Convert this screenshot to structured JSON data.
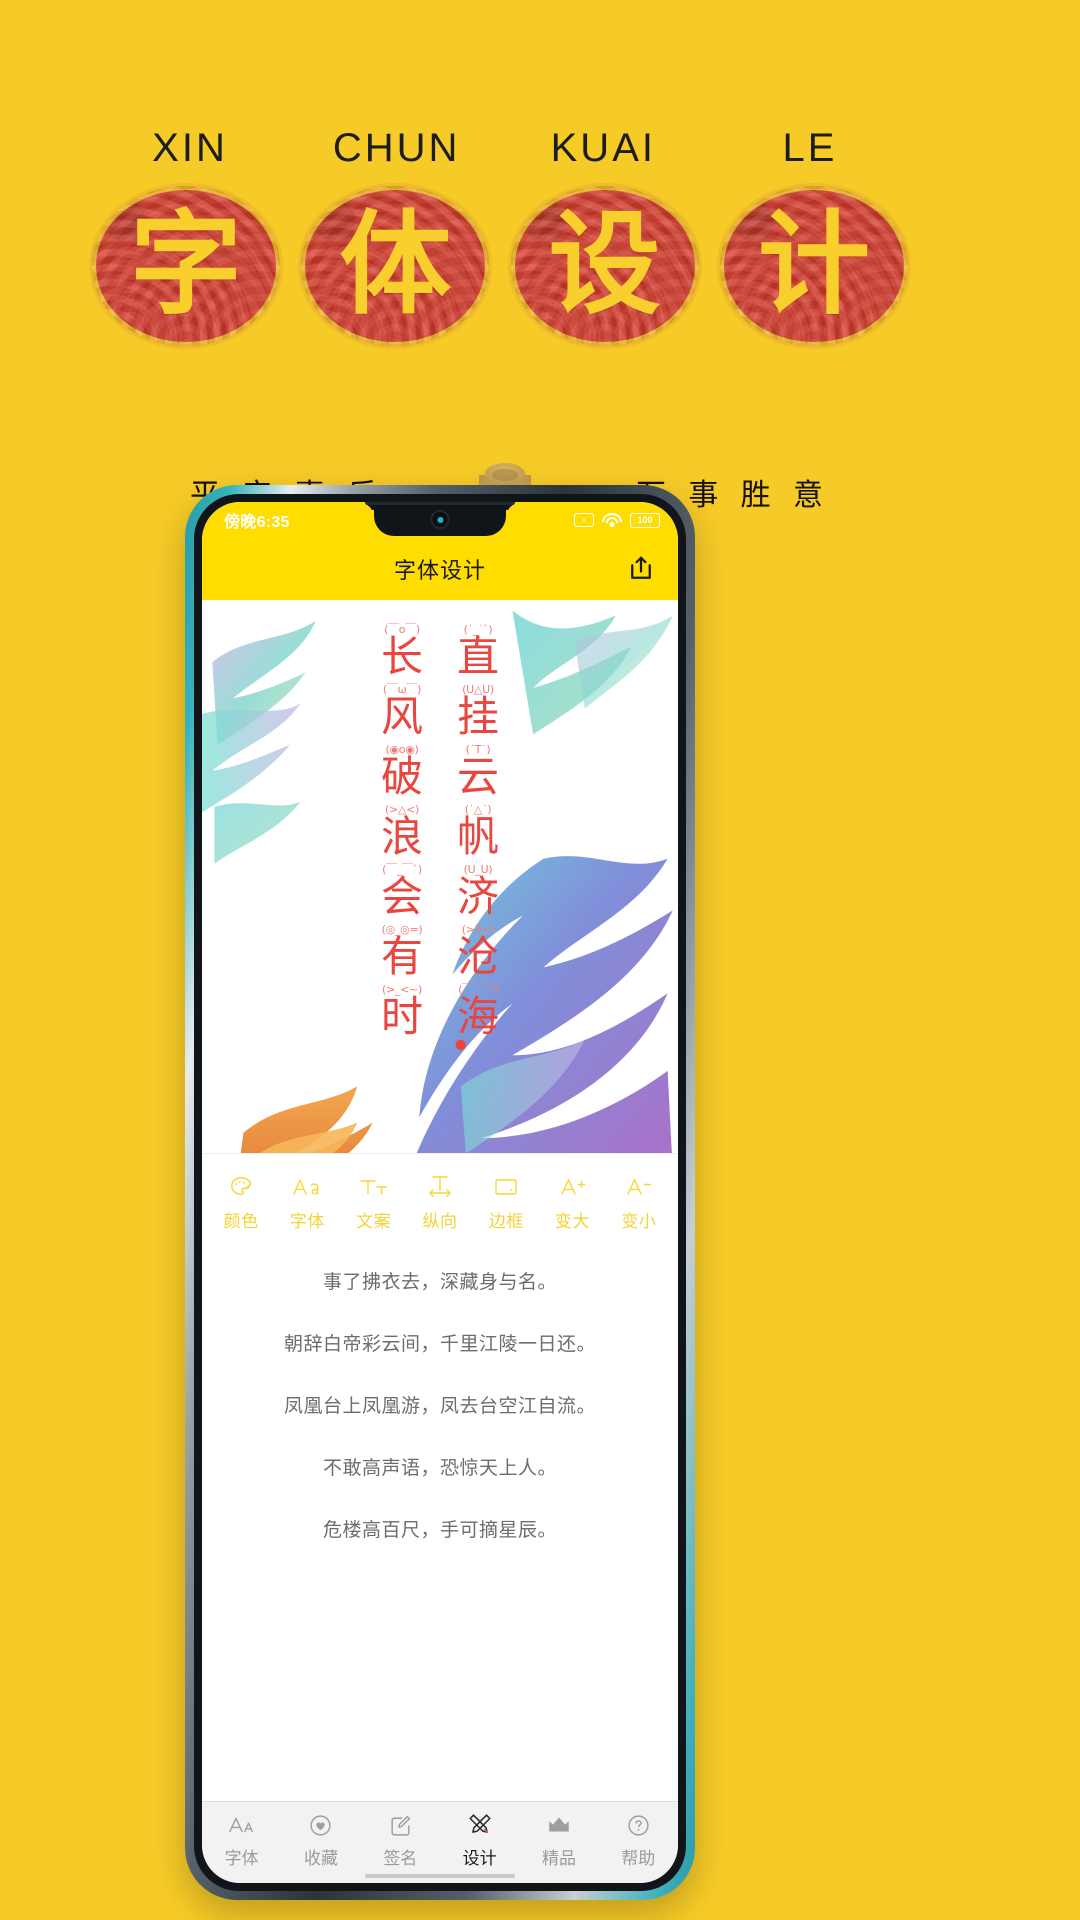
{
  "poster": {
    "background_color": "#f6ca27",
    "pinyin": [
      "XIN",
      "CHUN",
      "KUAI",
      "LE"
    ],
    "seal_chars": [
      "字",
      "体",
      "设",
      "计"
    ],
    "seal_color": "#d0392c",
    "seal_text_color": "#f9cf2e",
    "blessing_left": "平 安 喜 乐",
    "blessing_right": "万 事 胜 意",
    "ingot_icon": "gold-ingot-icon"
  },
  "phone": {
    "statusbar": {
      "time": "傍晚6:35",
      "no_signal_icon": "signal-off-icon",
      "no_signal_glyph": "×",
      "wifi_icon": "wifi-icon",
      "battery_icon": "battery-icon",
      "battery_level": "100"
    },
    "header": {
      "title": "字体设计",
      "share_icon": "share-export-icon",
      "accent_color": "#FFDD00"
    },
    "canvas": {
      "text_color": "#e8463f",
      "columns": [
        {
          "cells": [
            {
              "emoticon": "(￣o￣)",
              "char": "长"
            },
            {
              "emoticon": "(￣ω￣)",
              "char": "风"
            },
            {
              "emoticon": "(◉o◉)",
              "char": "破"
            },
            {
              "emoticon": "(>△<)",
              "char": "浪"
            },
            {
              "emoticon": "(￣_￣`)",
              "char": "会"
            },
            {
              "emoticon": "(◎_◎=)",
              "char": "有"
            },
            {
              "emoticon": "(>_<~)",
              "char": "时"
            }
          ]
        },
        {
          "cells": [
            {
              "emoticon": "(˙_˙`)",
              "char": "直"
            },
            {
              "emoticon": "(U△U)",
              "char": "挂"
            },
            {
              "emoticon": "(˙T˙)",
              "char": "云"
            },
            {
              "emoticon": "(˙△˙)",
              "char": "帆"
            },
            {
              "emoticon": "(U_U)",
              "char": "济"
            },
            {
              "emoticon": "(>3<)",
              "char": "沧"
            },
            {
              "emoticon": "(￣_￣*)",
              "char": "海"
            }
          ]
        }
      ]
    },
    "toolbar": {
      "color": "#f3d338",
      "items": [
        {
          "label": "颜色",
          "icon": "palette-icon"
        },
        {
          "label": "字体",
          "icon": "font-aa-icon"
        },
        {
          "label": "文案",
          "icon": "text-size-icon"
        },
        {
          "label": "纵向",
          "icon": "orientation-vertical-icon"
        },
        {
          "label": "边框",
          "icon": "border-frame-icon"
        },
        {
          "label": "变大",
          "icon": "font-increase-icon"
        },
        {
          "label": "变小",
          "icon": "font-decrease-icon"
        }
      ]
    },
    "poem_list": [
      "事了拂衣去，深藏身与名。",
      "朝辞白帝彩云间，千里江陵一日还。",
      "凤凰台上凤凰游，凤去台空江自流。",
      "不敢高声语，恐惊天上人。",
      "危楼高百尺，手可摘星辰。"
    ],
    "bottomnav": {
      "items": [
        {
          "label": "字体",
          "icon": "font-aa-icon",
          "active": false
        },
        {
          "label": "收藏",
          "icon": "heart-circle-icon",
          "active": false
        },
        {
          "label": "签名",
          "icon": "signature-pen-icon",
          "active": false
        },
        {
          "label": "设计",
          "icon": "design-pencils-icon",
          "active": true
        },
        {
          "label": "精品",
          "icon": "crown-icon",
          "active": false
        },
        {
          "label": "帮助",
          "icon": "help-question-icon",
          "active": false
        }
      ]
    }
  }
}
